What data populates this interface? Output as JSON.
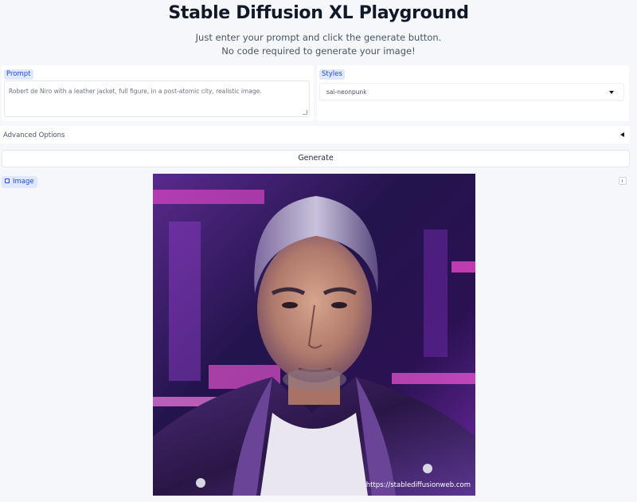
{
  "header": {
    "title": "Stable Diffusion XL Playground",
    "subtitle_line1": "Just enter your prompt and click the generate button.",
    "subtitle_line2": "No code required to generate your image!"
  },
  "prompt": {
    "label": "Prompt",
    "value": "Robert de Niro with a leather jacket, full figure, in a post-atomic city, realistic image."
  },
  "styles": {
    "label": "Styles",
    "selected": "sai-neonpunk"
  },
  "advanced": {
    "label": "Advanced Options"
  },
  "generate": {
    "label": "Generate"
  },
  "output": {
    "label": "Image",
    "watermark": "https://stablediffusionweb.com"
  },
  "colors": {
    "background": "#f5f7fa",
    "label_bg": "#e0e7ff",
    "label_text": "#1d4ed8",
    "neon_pink": "#ff4fd8",
    "neon_purple": "#7b2ff7"
  },
  "icons": [
    "image-icon",
    "chevron-down-icon",
    "chevron-left-icon",
    "download-icon"
  ]
}
